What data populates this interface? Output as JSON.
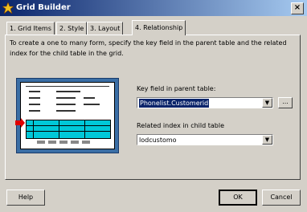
{
  "window": {
    "title": "Grid Builder",
    "close_symbol": "×"
  },
  "tabs": [
    {
      "label": "1. Grid Items"
    },
    {
      "label": "2. Style"
    },
    {
      "label": "3. Layout"
    },
    {
      "label": "4. Relationship",
      "active": true
    }
  ],
  "main": {
    "intro": "To create a one to many form, specify the key field in the parent table and the related index for the child table in the grid.",
    "key_field": {
      "label": "Key field in parent table:",
      "value": "Phonelist.Customerid",
      "browse_label": "..."
    },
    "related_index": {
      "label": "Related index in child table",
      "value": "lodcustomo"
    }
  },
  "footer": {
    "help_label": "Help",
    "ok_label": "OK",
    "cancel_label": "Cancel"
  },
  "colors": {
    "title_bar": "#0a246a",
    "selection": "#0a246a",
    "grid_highlight": "#00c8d8",
    "arrow": "#e00000"
  }
}
